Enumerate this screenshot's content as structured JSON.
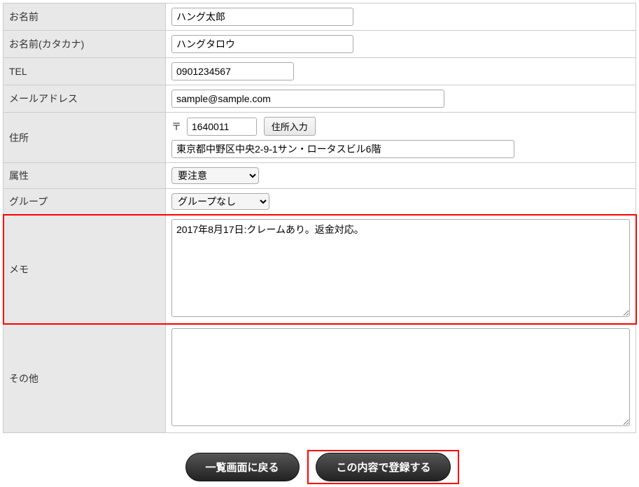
{
  "fields": {
    "name": {
      "label": "お名前",
      "value": "ハング太郎"
    },
    "kana": {
      "label": "お名前(カタカナ)",
      "value": "ハングタロウ"
    },
    "tel": {
      "label": "TEL",
      "value": "0901234567"
    },
    "email": {
      "label": "メールアドレス",
      "value": "sample@sample.com"
    },
    "address": {
      "label": "住所",
      "postal_symbol": "〒",
      "postal": "1640011",
      "lookup_button": "住所入力",
      "full": "東京都中野区中央2-9-1サン・ロータスビル6階"
    },
    "attribute": {
      "label": "属性",
      "selected": "要注意"
    },
    "group": {
      "label": "グループ",
      "selected": "グループなし"
    },
    "memo": {
      "label": "メモ",
      "value": "2017年8月17日:クレームあり。返金対応。"
    },
    "other": {
      "label": "その他",
      "value": ""
    }
  },
  "buttons": {
    "back": "一覧画面に戻る",
    "submit": "この内容で登録する"
  }
}
